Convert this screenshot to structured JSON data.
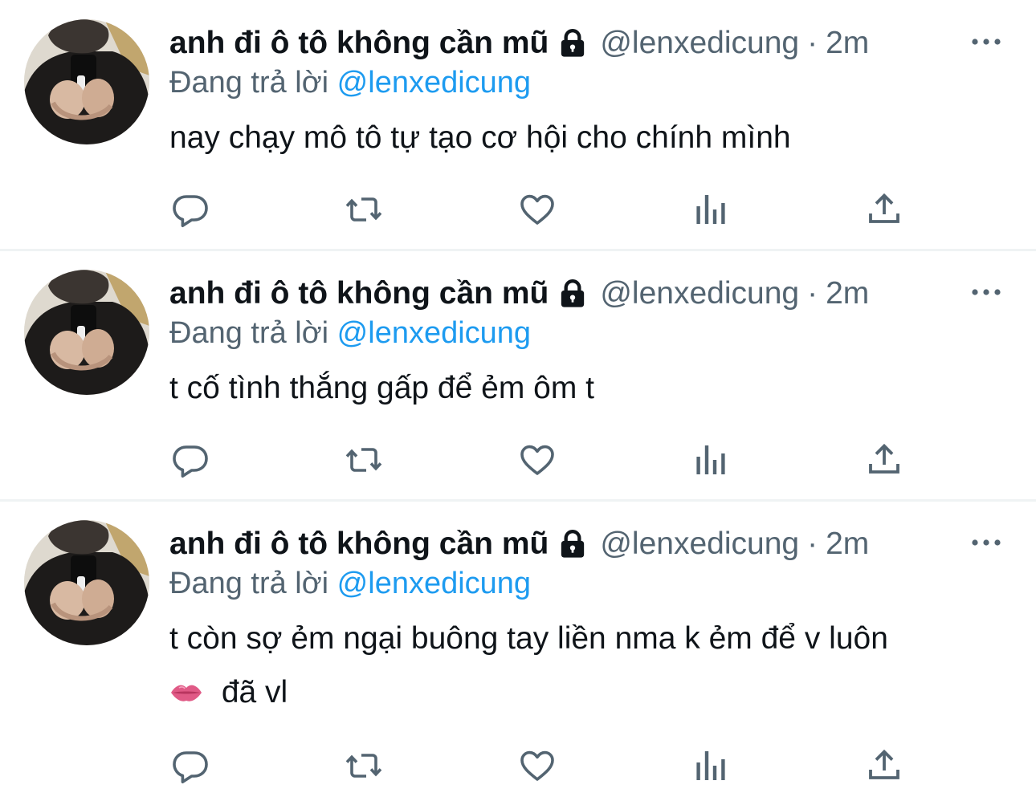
{
  "tweets": [
    {
      "display_name": "anh đi ô tô không cần mũ",
      "handle": "@lenxedicung",
      "dot": "·",
      "time": "2m",
      "reply_prefix": "Đang trả lời",
      "reply_to": "@lenxedicung",
      "text_lines": [
        "nay chạy mô tô tự tạo cơ hội cho chính mình"
      ]
    },
    {
      "display_name": "anh đi ô tô không cần mũ",
      "handle": "@lenxedicung",
      "dot": "·",
      "time": "2m",
      "reply_prefix": "Đang trả lời",
      "reply_to": "@lenxedicung",
      "text_lines": [
        "t cố tình thắng gấp để ẻm ôm t"
      ]
    },
    {
      "display_name": "anh đi ô tô không cần mũ",
      "handle": "@lenxedicung",
      "dot": "·",
      "time": "2m",
      "reply_prefix": "Đang trả lời",
      "reply_to": "@lenxedicung",
      "text_lines": [
        "t còn sợ ẻm ngại buông tay liền nma k ẻm để v luôn",
        "đã vl"
      ],
      "emoji": "lips-emoji"
    }
  ],
  "icons": {
    "lock": "lock-icon",
    "more": "more-horizontal-icon",
    "reply": "reply-icon",
    "retweet": "retweet-icon",
    "like": "heart-icon",
    "views": "views-icon",
    "share": "share-icon"
  },
  "colors": {
    "text": "#0f1419",
    "secondary": "#536471",
    "accent": "#1d9bf0",
    "divider": "#eff3f4"
  }
}
